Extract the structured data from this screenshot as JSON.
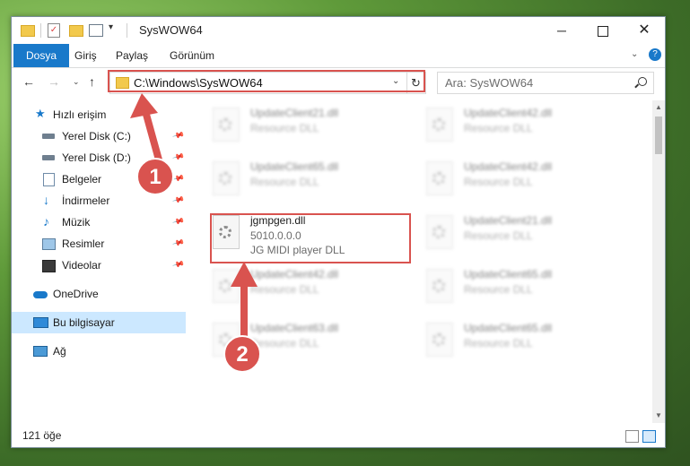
{
  "window": {
    "title": "SysWOW64",
    "controls": {
      "minimize": "─",
      "close": "✕"
    }
  },
  "quick_access_toolbar": {
    "dropdown": "▾"
  },
  "ribbon": {
    "tabs": [
      "Dosya",
      "Giriş",
      "Paylaş",
      "Görünüm"
    ],
    "collapse_chevron": "⌄",
    "help": "?"
  },
  "navigation": {
    "back": "←",
    "forward": "→",
    "recent": "⌄",
    "up": "↑"
  },
  "address_bar": {
    "path": "C:\\Windows\\SysWOW64",
    "dropdown": "⌄",
    "refresh": "↻"
  },
  "search": {
    "placeholder": "Ara: SysWOW64"
  },
  "sidebar": {
    "quick_access_label": "Hızlı erişim",
    "items": [
      {
        "label": "Yerel Disk (C:)",
        "icon": "disk-icon",
        "pinned": true
      },
      {
        "label": "Yerel Disk (D:)",
        "icon": "disk-icon",
        "pinned": true
      },
      {
        "label": "Belgeler",
        "icon": "documents-icon",
        "pinned": true
      },
      {
        "label": "İndirmeler",
        "icon": "downloads-icon",
        "pinned": true
      },
      {
        "label": "Müzik",
        "icon": "music-icon",
        "pinned": true
      },
      {
        "label": "Resimler",
        "icon": "pictures-icon",
        "pinned": true
      },
      {
        "label": "Videolar",
        "icon": "videos-icon",
        "pinned": true
      }
    ],
    "onedrive": "OneDrive",
    "this_pc": "Bu bilgisayar",
    "network": "Ağ"
  },
  "files": [
    {
      "name": "UpdateClient21.dll",
      "line1": "Resource DLL",
      "line2": "",
      "blurred": true
    },
    {
      "name": "UpdateClient42.dll",
      "line1": "Resource DLL",
      "line2": "",
      "blurred": true
    },
    {
      "name": "UpdateClient65.dll",
      "line1": "Resource DLL",
      "line2": "",
      "blurred": true
    },
    {
      "name": "UpdateClient42.dll",
      "line1": "Resource DLL",
      "line2": "",
      "blurred": true
    },
    {
      "name": "jgmpgen.dll",
      "line1": "5010.0.0.0",
      "line2": "JG MIDI player DLL",
      "blurred": false
    },
    {
      "name": "UpdateClient21.dll",
      "line1": "Resource DLL",
      "line2": "",
      "blurred": true
    },
    {
      "name": "UpdateClient42.dll",
      "line1": "Resource DLL",
      "line2": "",
      "blurred": true
    },
    {
      "name": "UpdateClient65.dll",
      "line1": "Resource DLL",
      "line2": "",
      "blurred": true
    },
    {
      "name": "UpdateClient63.dll",
      "line1": "Resource DLL",
      "line2": "",
      "blurred": true
    },
    {
      "name": "UpdateClient65.dll",
      "line1": "Resource DLL",
      "line2": "",
      "blurred": true
    }
  ],
  "status_bar": {
    "item_count": "121 öğe"
  },
  "annotations": {
    "step1": "1",
    "step2": "2",
    "color": "#d9534f"
  },
  "colors": {
    "accent": "#1979ca",
    "selection": "#cce8ff",
    "highlight": "#d9534f"
  }
}
